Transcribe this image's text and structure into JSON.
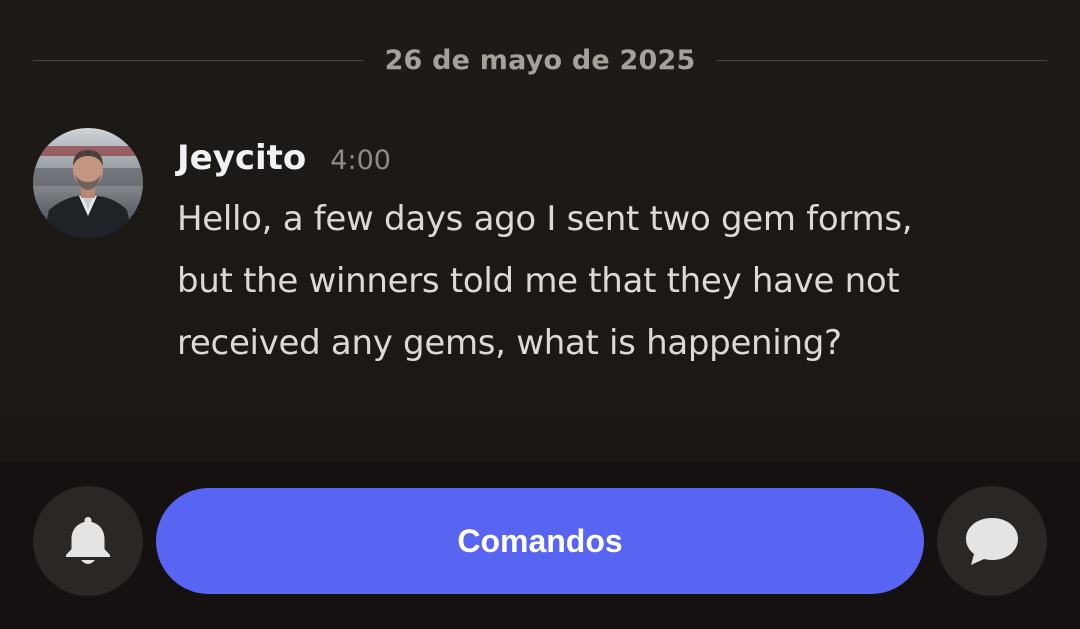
{
  "divider": {
    "date": "26 de mayo de 2025"
  },
  "message": {
    "username": "Jeycito",
    "time": "4:00",
    "lines": [
      "Hello, a few days ago I sent two gem forms,",
      "but the winners told me that they have not",
      "received any gems, what is happening?"
    ],
    "avatar_icon": "user-avatar-photo"
  },
  "bottom_bar": {
    "left_icon": "bell-icon",
    "button_label": "Comandos",
    "button_color": "#5865f2",
    "right_icon": "chat-bubble-icon"
  }
}
